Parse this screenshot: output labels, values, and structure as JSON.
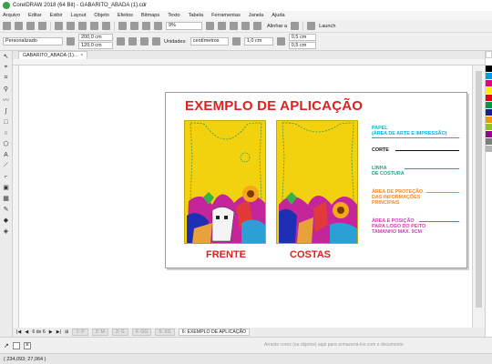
{
  "window": {
    "title": "CorelDRAW 2018 (64 Bit) - GABARITO_ABADA (1).cdr"
  },
  "menu": [
    "Arquivo",
    "Editar",
    "Exibir",
    "Layout",
    "Objeto",
    "Efeitos",
    "Bitmaps",
    "Texto",
    "Tabela",
    "Ferramentas",
    "Janela",
    "Ajuda"
  ],
  "toolbar": {
    "zoom": "9%",
    "snap": "Alinhar a",
    "launch": "Launch"
  },
  "propertybar": {
    "page_preset": "Personalizado",
    "width": "200,0 cm",
    "height": "120,0 cm",
    "units_label": "Unidades:",
    "units": "centímetros",
    "nudge": "1,0 cm",
    "dup_x": "0,5 cm",
    "dup_y": "0,5 cm"
  },
  "document_tab": {
    "label": "GABARITO_ABADA (1)..."
  },
  "canvas": {
    "heading": "EXEMPLO DE APLICAÇÃO",
    "front_label": "FRENTE",
    "back_label": "COSTAS",
    "legend": [
      {
        "text": "PAPEL\n(ÁREA DE ARTE E IMPRESSÃO)",
        "color": "#00b6d6"
      },
      {
        "text": "CORTE",
        "color": "#111111"
      },
      {
        "text": "LINHA\nDE COSTURA",
        "color": "#1aa88a"
      },
      {
        "text": "ÁREA DE PROTEÇÃO\nDAS INFORMAÇÕES\nPRINCIPAIS",
        "color": "#f08a2a"
      },
      {
        "text": "ÁREA E POSIÇÃO\nPARA LOGO DO PEITO\nTAMANHO MAX. 9CM",
        "color": "#d040b0"
      }
    ]
  },
  "pagebar": {
    "page_counter": "6 de 6",
    "tabs": [
      "1: P",
      "2: M",
      "3: G",
      "4: GG",
      "5: XG",
      "6: EXEMPLO DE APLICAÇÃO"
    ],
    "hint": "Arraste cores (ou objetos) aqui para armazená-los com o documento"
  },
  "statusbar": {
    "coords": "( 234,093; 27,064 )"
  }
}
